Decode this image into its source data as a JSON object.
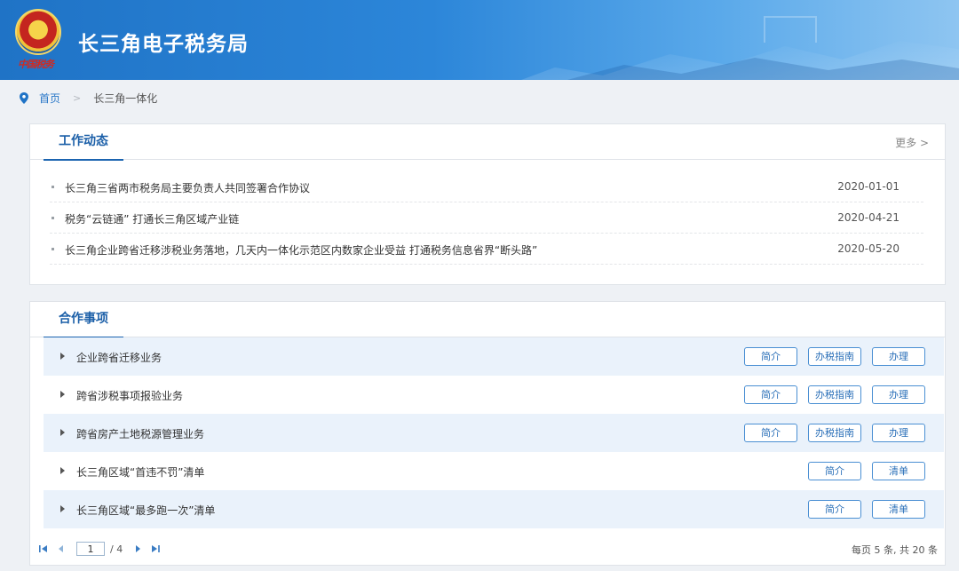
{
  "header": {
    "site_title": "长三角电子税务局",
    "emblem_text": "中国税务"
  },
  "breadcrumb": {
    "home": "首页",
    "separator": ">",
    "current": "长三角一体化"
  },
  "news": {
    "title": "工作动态",
    "more": "更多 >",
    "items": [
      {
        "text": "长三角三省两市税务局主要负责人共同签署合作协议",
        "date": "2020-01-01"
      },
      {
        "text": "税务“云链通” 打通长三角区域产业链",
        "date": "2020-04-21"
      },
      {
        "text": "长三角企业跨省迁移涉税业务落地，几天内一体化示范区内数家企业受益 打通税务信息省界“断头路”",
        "date": "2020-05-20"
      }
    ]
  },
  "cooperation": {
    "title": "合作事项",
    "items": [
      {
        "name": "企业跨省迁移业务",
        "buttons": [
          "简介",
          "办税指南",
          "办理"
        ]
      },
      {
        "name": "跨省涉税事项报验业务",
        "buttons": [
          "简介",
          "办税指南",
          "办理"
        ]
      },
      {
        "name": "跨省房产土地税源管理业务",
        "buttons": [
          "简介",
          "办税指南",
          "办理"
        ]
      },
      {
        "name": "长三角区域“首违不罚”清单",
        "buttons": [
          "简介",
          "清单"
        ]
      },
      {
        "name": "长三角区域“最多跑一次”清单",
        "buttons": [
          "简介",
          "清单"
        ]
      }
    ]
  },
  "pager": {
    "current_page": "1",
    "total_pages": "/ 4",
    "info": "每页 5 条, 共 20 条"
  },
  "colors": {
    "brand_blue": "#1f73c6",
    "title_blue": "#1b5fa8",
    "row_highlight": "#eaf2fb"
  }
}
